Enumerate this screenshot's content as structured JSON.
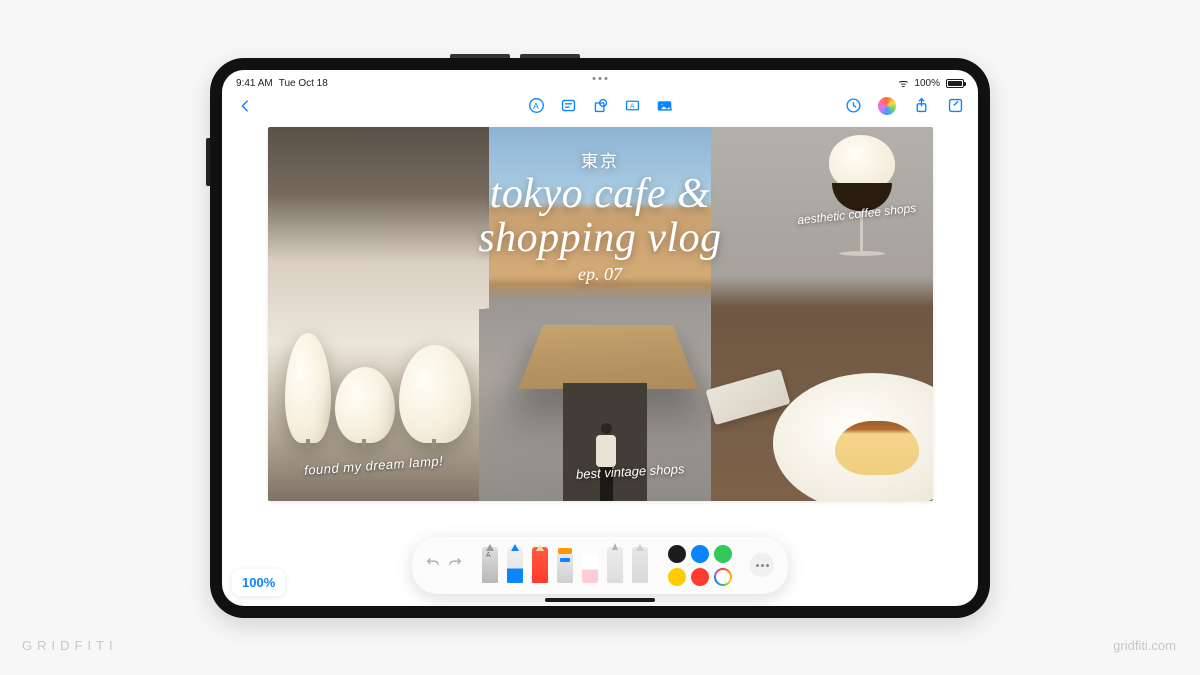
{
  "watermark": {
    "brand": "GRIDFITI",
    "url": "gridfiti.com"
  },
  "status": {
    "time": "9:41 AM",
    "date": "Tue Oct 18",
    "battery": "100%"
  },
  "canvas": {
    "subtitle": "東京",
    "title_line1": "tokyo cafe &",
    "title_line2": "shopping vlog",
    "episode": "ep. 07",
    "panel1_note": "found my dream lamp!",
    "panel2_note": "best vintage shops",
    "panel3_note": "aesthetic coffee shops"
  },
  "zoom": "100%",
  "colors": [
    "#1c1c1e",
    "#0a84ff",
    "#34c759",
    "#ffcc00",
    "#ff3b30",
    "multi"
  ]
}
